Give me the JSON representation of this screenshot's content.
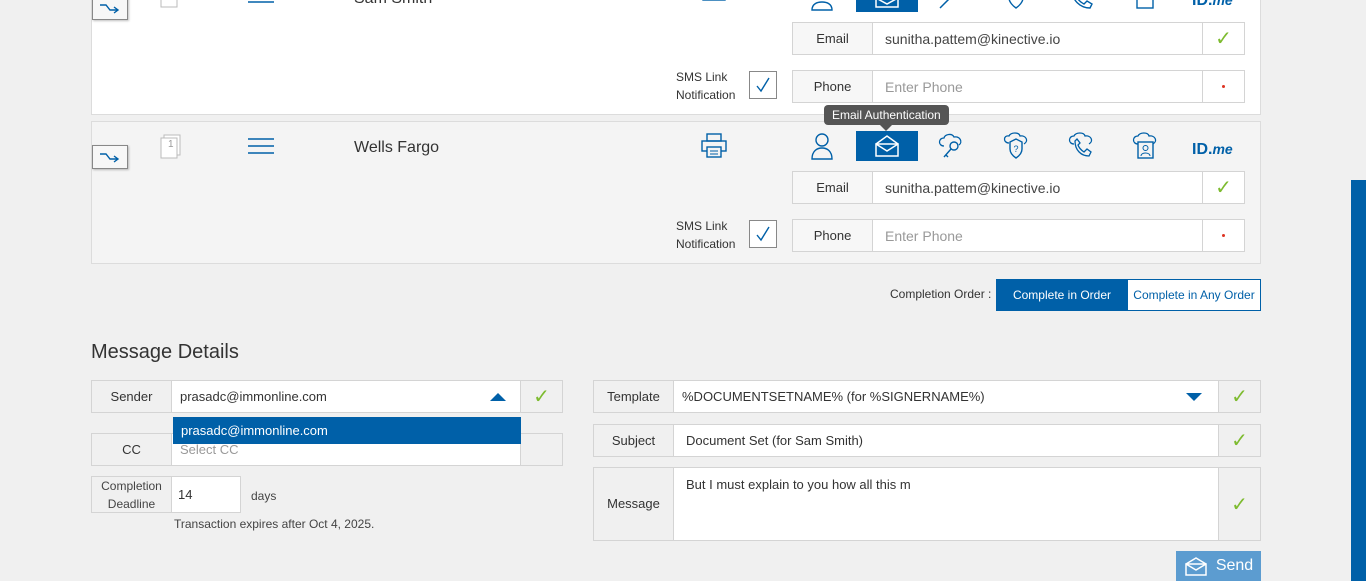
{
  "signers": [
    {
      "name": "Sam Smith",
      "email_label": "Email",
      "email_value": "sunitha.pattem@kinective.io",
      "phone_label": "Phone",
      "phone_placeholder": "Enter Phone",
      "sms_label_1": "SMS Link",
      "sms_label_2": "Notification",
      "idme": "ID.",
      "idme_suffix": "me"
    },
    {
      "doc_count": "1",
      "name": "Wells Fargo",
      "email_label": "Email",
      "email_value": "sunitha.pattem@kinective.io",
      "phone_label": "Phone",
      "phone_placeholder": "Enter Phone",
      "sms_label_1": "SMS Link",
      "sms_label_2": "Notification",
      "idme": "ID.",
      "idme_suffix": "me"
    }
  ],
  "tooltip": "Email Authentication",
  "completion_order": {
    "label": "Completion Order :",
    "option_in_order": "Complete in Order",
    "option_any_order": "Complete in Any Order",
    "selected": "Complete in Order"
  },
  "message_details": {
    "title": "Message Details",
    "sender_label": "Sender",
    "sender_value": "prasadc@immonline.com",
    "sender_dropdown_option": "prasadc@immonline.com",
    "cc_label": "CC",
    "cc_placeholder": "Select CC",
    "deadline_label_1": "Completion",
    "deadline_label_2": "Deadline",
    "deadline_value": "14",
    "deadline_unit": "days",
    "expiry_note": "Transaction expires after Oct 4, 2025.",
    "template_label": "Template",
    "template_value": "%DOCUMENTSETNAME% (for %SIGNERNAME%)",
    "subject_label": "Subject",
    "subject_value": "Document Set (for Sam Smith)",
    "message_label": "Message",
    "message_value": "But I must explain to you how all this m",
    "send_label": "Send"
  },
  "colors": {
    "accent": "#0060a8",
    "check": "#7dbb2f",
    "send": "#5c9cd0"
  }
}
